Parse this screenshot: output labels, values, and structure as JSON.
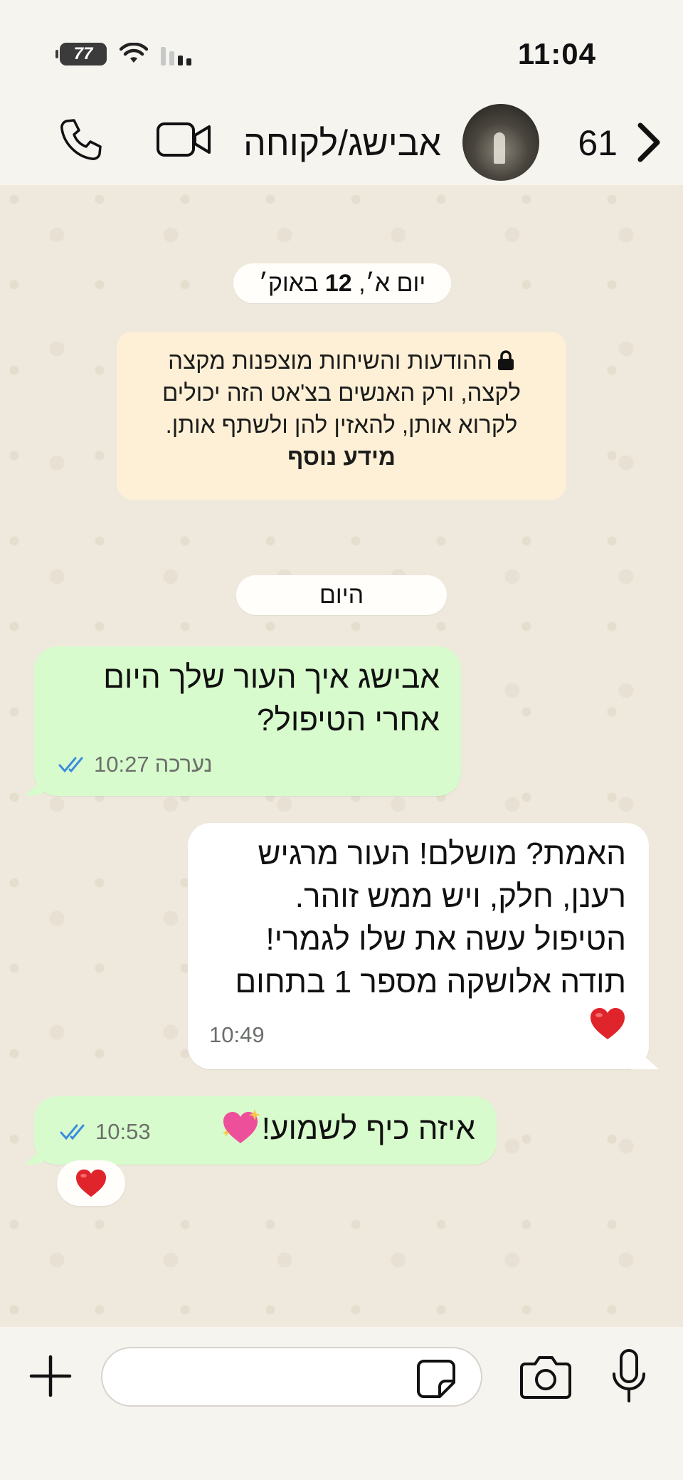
{
  "status_bar": {
    "time": "11:04",
    "battery": "77"
  },
  "header": {
    "unread_count": "61",
    "contact_name": "אבישג/לקוחה"
  },
  "chat": {
    "date_chip_1": {
      "prefix": "יום א׳, ",
      "day": "12",
      "month": " באוק׳"
    },
    "encryption_notice": {
      "text": "ההודעות והשיחות מוצפנות מקצה לקצה, ורק האנשים בצ'אט הזה יכולים לקרוא אותן, להאזין להן ולשתף אותן. ",
      "link": "מידע נוסף"
    },
    "date_chip_2": "היום",
    "messages": [
      {
        "text": "אבישג איך העור שלך היום אחרי הטיפול?",
        "edited_label": "נערכה",
        "time": "10:27",
        "status": "read"
      },
      {
        "text": "האמת? מושלם! העור מרגיש רענן, חלק, ויש ממש זוהר. הטיפול עשה את שלו לגמרי! תודה אלושקה מספר 1 בתחום",
        "emoji": "red-heart",
        "time": "10:49"
      },
      {
        "text": "איזה כיף לשמוע!",
        "emoji": "sparkling-heart",
        "time": "10:53",
        "status": "read"
      }
    ],
    "reaction": "red-heart"
  },
  "input": {
    "placeholder": ""
  },
  "colors": {
    "outgoing_bubble": "#d8fbcd",
    "incoming_bubble": "#ffffff",
    "read_ticks": "#3a8ce0",
    "notice_bg": "#fdf0d6"
  }
}
